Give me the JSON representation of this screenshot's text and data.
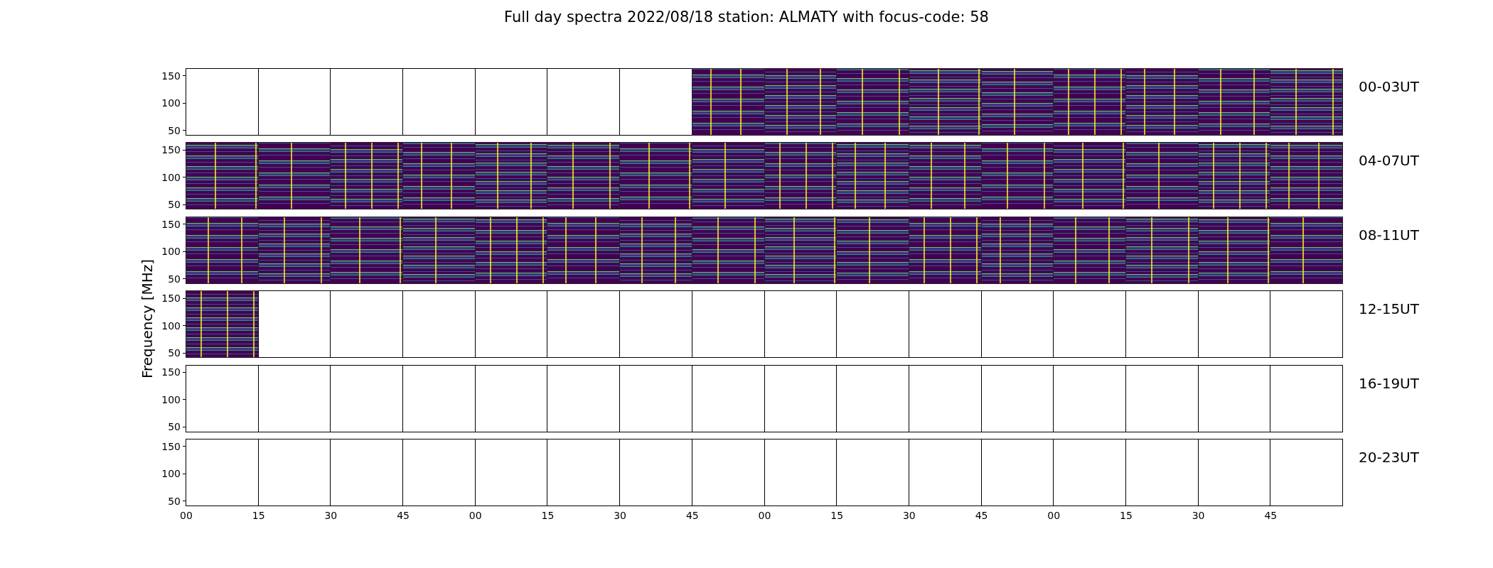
{
  "title": "Full day spectra 2022/08/18 station: ALMATY with focus-code: 58",
  "y_axis_label": "Frequency [MHz]",
  "rows": [
    {
      "label": "00-03UT",
      "yticks": [
        "150",
        "100",
        "50"
      ],
      "panels": [
        {
          "has_data": false
        },
        {
          "has_data": false
        },
        {
          "has_data": false
        },
        {
          "has_data": false
        },
        {
          "has_data": false
        },
        {
          "has_data": false
        },
        {
          "has_data": false
        },
        {
          "has_data": true
        },
        {
          "has_data": true
        },
        {
          "has_data": true
        },
        {
          "has_data": true
        },
        {
          "has_data": true
        },
        {
          "has_data": true
        },
        {
          "has_data": true
        },
        {
          "has_data": true
        },
        {
          "has_data": true
        }
      ]
    },
    {
      "label": "04-07UT",
      "yticks": [
        "150",
        "100",
        "50"
      ],
      "panels": [
        {
          "has_data": true
        },
        {
          "has_data": true
        },
        {
          "has_data": true
        },
        {
          "has_data": true
        },
        {
          "has_data": true
        },
        {
          "has_data": true
        },
        {
          "has_data": true
        },
        {
          "has_data": true
        },
        {
          "has_data": true
        },
        {
          "has_data": true
        },
        {
          "has_data": true
        },
        {
          "has_data": true
        },
        {
          "has_data": true
        },
        {
          "has_data": true
        },
        {
          "has_data": true
        },
        {
          "has_data": true
        }
      ]
    },
    {
      "label": "08-11UT",
      "yticks": [
        "150",
        "100",
        "50"
      ],
      "panels": [
        {
          "has_data": true
        },
        {
          "has_data": true
        },
        {
          "has_data": true
        },
        {
          "has_data": true
        },
        {
          "has_data": true
        },
        {
          "has_data": true
        },
        {
          "has_data": true
        },
        {
          "has_data": true
        },
        {
          "has_data": true
        },
        {
          "has_data": true
        },
        {
          "has_data": true
        },
        {
          "has_data": true
        },
        {
          "has_data": true
        },
        {
          "has_data": true
        },
        {
          "has_data": true
        },
        {
          "has_data": true
        }
      ]
    },
    {
      "label": "12-15UT",
      "yticks": [
        "150",
        "100",
        "50"
      ],
      "panels": [
        {
          "has_data": true
        },
        {
          "has_data": false
        },
        {
          "has_data": false
        },
        {
          "has_data": false
        },
        {
          "has_data": false
        },
        {
          "has_data": false
        },
        {
          "has_data": false
        },
        {
          "has_data": false
        },
        {
          "has_data": false
        },
        {
          "has_data": false
        },
        {
          "has_data": false
        },
        {
          "has_data": false
        },
        {
          "has_data": false
        },
        {
          "has_data": false
        },
        {
          "has_data": false
        },
        {
          "has_data": false
        }
      ]
    },
    {
      "label": "16-19UT",
      "yticks": [
        "150",
        "100",
        "50"
      ],
      "panels": [
        {
          "has_data": false
        },
        {
          "has_data": false
        },
        {
          "has_data": false
        },
        {
          "has_data": false
        },
        {
          "has_data": false
        },
        {
          "has_data": false
        },
        {
          "has_data": false
        },
        {
          "has_data": false
        },
        {
          "has_data": false
        },
        {
          "has_data": false
        },
        {
          "has_data": false
        },
        {
          "has_data": false
        },
        {
          "has_data": false
        },
        {
          "has_data": false
        },
        {
          "has_data": false
        },
        {
          "has_data": false
        }
      ]
    },
    {
      "label": "20-23UT",
      "yticks": [
        "150",
        "100",
        "50"
      ],
      "panels": [
        {
          "has_data": false
        },
        {
          "has_data": false
        },
        {
          "has_data": false
        },
        {
          "has_data": false
        },
        {
          "has_data": false
        },
        {
          "has_data": false
        },
        {
          "has_data": false
        },
        {
          "has_data": false
        },
        {
          "has_data": false
        },
        {
          "has_data": false
        },
        {
          "has_data": false
        },
        {
          "has_data": false
        },
        {
          "has_data": false
        },
        {
          "has_data": false
        },
        {
          "has_data": false
        },
        {
          "has_data": false
        }
      ]
    }
  ],
  "xticks": [
    "00",
    "15",
    "30",
    "45",
    "00",
    "15",
    "30",
    "45",
    "00",
    "15",
    "30",
    "45",
    "00",
    "15",
    "30",
    "45"
  ]
}
